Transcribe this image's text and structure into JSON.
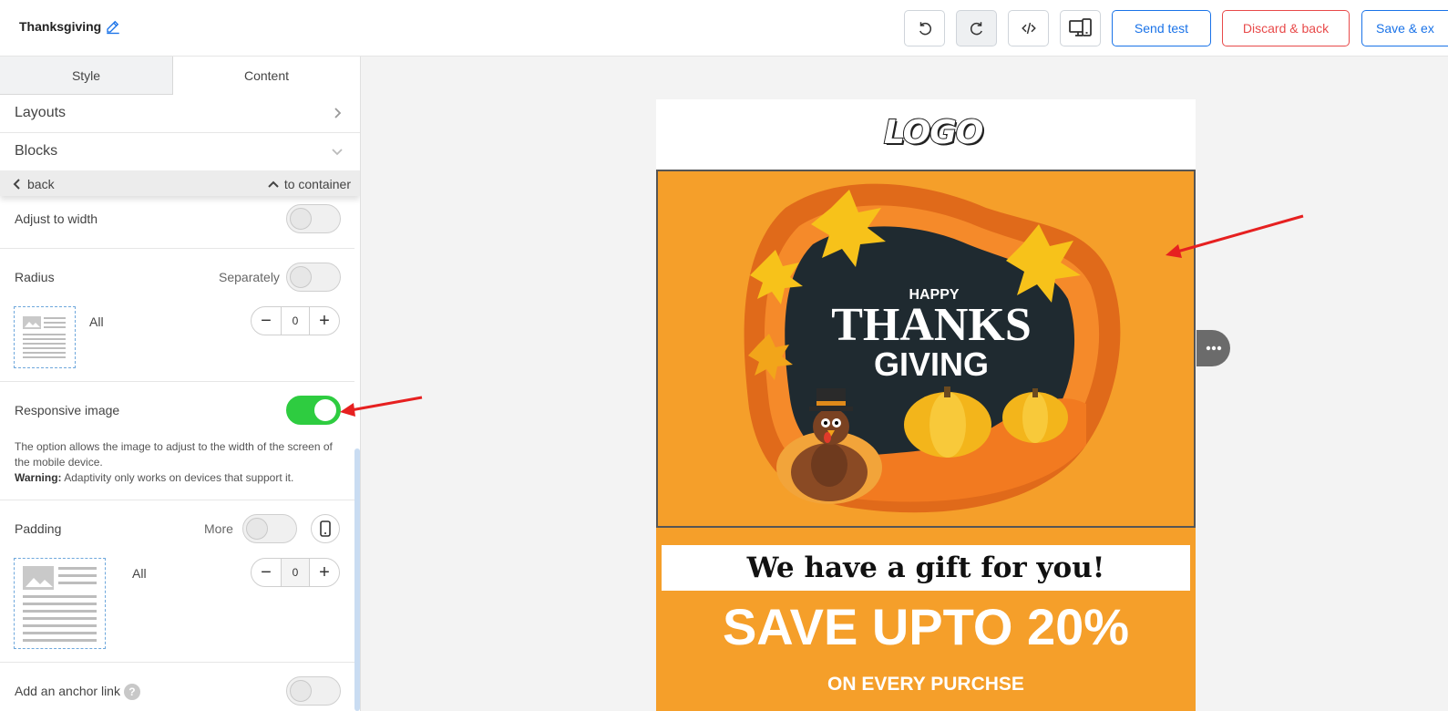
{
  "header": {
    "title": "Thanksgiving",
    "send_test": "Send test",
    "discard_back": "Discard & back",
    "save_exit": "Save & ex"
  },
  "panel": {
    "tabs": {
      "style": "Style",
      "content": "Content"
    },
    "layouts": "Layouts",
    "blocks": "Blocks",
    "nav": {
      "back": "back",
      "to_container": "to container"
    },
    "adjust_width": {
      "label": "Adjust to width",
      "on": false
    },
    "radius": {
      "label": "Radius",
      "separately": "Separately",
      "all": "All",
      "value": "0"
    },
    "responsive": {
      "label": "Responsive image",
      "on": true,
      "desc": "The option allows the image to adjust to the width of the screen of the mobile device.",
      "warning_label": "Warning:",
      "warning_text": "Adaptivity only works on devices that support it."
    },
    "padding": {
      "label": "Padding",
      "more": "More",
      "all": "All",
      "value": "0"
    },
    "anchor": {
      "label": "Add an anchor link",
      "help": "?"
    }
  },
  "email": {
    "logo": "LOGO",
    "hero": {
      "happy": "HAPPY",
      "thanks": "THANKS",
      "giving": "GIVING"
    },
    "gift": "We have a gift for you!",
    "save": "SAVE UPTO 20%",
    "every": "ON EVERY PURCHSE"
  },
  "colors": {
    "accent_blue": "#1a73e8",
    "danger_red": "#e84a4a",
    "toggle_on": "#2ecc40",
    "email_orange": "#f59f2a"
  }
}
